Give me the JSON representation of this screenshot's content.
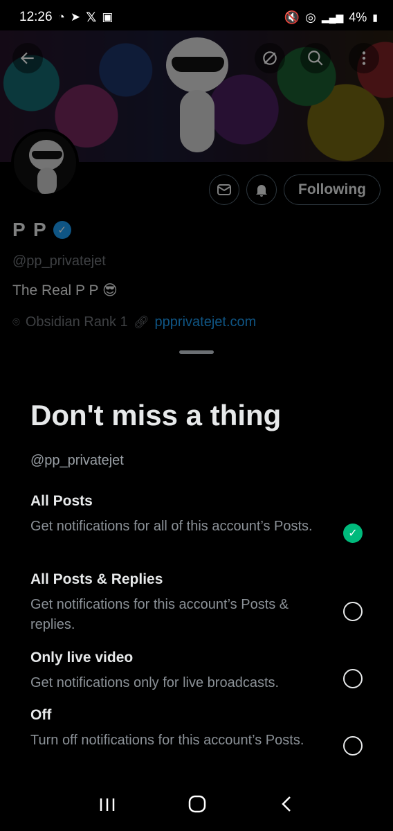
{
  "status": {
    "time": "12:26",
    "battery": "4%"
  },
  "profile": {
    "name": "P P",
    "handle": "@pp_privatejet",
    "bio": "The Real P P 😎",
    "location": "Obsidian Rank 1",
    "website": "ppprivatejet.com",
    "following_label": "Following"
  },
  "sheet": {
    "title": "Don't miss a thing",
    "handle": "@pp_privatejet",
    "options": [
      {
        "title": "All Posts",
        "desc": "Get notifications for all of this account’s Posts.",
        "selected": true
      },
      {
        "title": "All Posts & Replies",
        "desc": "Get notifications for this account’s Posts & replies.",
        "selected": false
      },
      {
        "title": "Only live video",
        "desc": "Get notifications only for live broadcasts.",
        "selected": false
      },
      {
        "title": "Off",
        "desc": "Turn off notifications for this account’s Posts.",
        "selected": false
      }
    ]
  },
  "icons": {
    "back": "back-arrow-icon",
    "grok": "grok-icon",
    "search": "search-icon",
    "more": "more-vertical-icon",
    "mail": "mail-icon",
    "bell": "bell-icon"
  },
  "colors": {
    "accent": "#1d9bf0",
    "selected": "#00ba7c"
  }
}
